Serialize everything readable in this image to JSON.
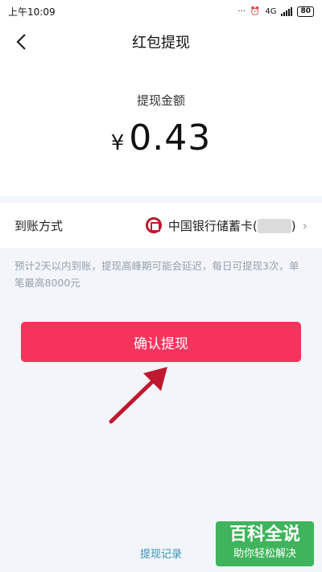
{
  "status_bar": {
    "time": "上午10:09",
    "network": "4G",
    "battery": "80"
  },
  "header": {
    "title": "红包提现"
  },
  "amount": {
    "label": "提现金额",
    "currency": "¥",
    "value": "0.43"
  },
  "method": {
    "label": "到账方式",
    "bank": "中国银行储蓄卡(",
    "bank_suffix": ")"
  },
  "notice": "预计2天以内到账，提现高峰期可能会延迟，每日可提现3次，单笔最高8000元",
  "confirm_button": "确认提现",
  "record_link": "提现记录",
  "watermark": {
    "main": "百科全说",
    "sub": "助你轻松解决"
  },
  "colors": {
    "primary": "#f5335c",
    "bank_red": "#c0182f",
    "link": "#3a8fb0",
    "watermark_green": "#3fb45c"
  }
}
